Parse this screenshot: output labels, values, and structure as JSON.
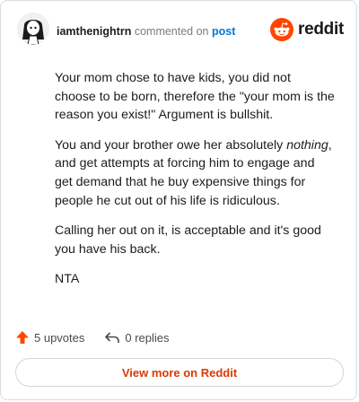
{
  "post": {
    "author": "iamthenightrn",
    "action_text": "commented on",
    "link_text": "post"
  },
  "brand": {
    "wordmark": "reddit",
    "icon": "reddit-snoo-icon",
    "color": "#ff4500"
  },
  "comment": {
    "paragraphs": [
      {
        "text": "Your mom chose to have kids, you did not choose to be born, therefore the \"your mom is the reason you exist!\" Argument is bullshit."
      },
      {
        "before": "You and your brother owe her absolutely ",
        "emphasis": "nothing",
        "after": ", and get attempts at forcing him to engage and get demand that he buy expensive things for people he cut out of his life is ridiculous."
      },
      {
        "text": "Calling her out on it, is acceptable and it's good you have his back."
      },
      {
        "text": "NTA"
      }
    ]
  },
  "stats": {
    "upvotes": "5 upvotes",
    "replies": "0 replies",
    "upvote_color": "#ff4500"
  },
  "cta": {
    "label": "View more on Reddit",
    "color": "#d93a00"
  }
}
